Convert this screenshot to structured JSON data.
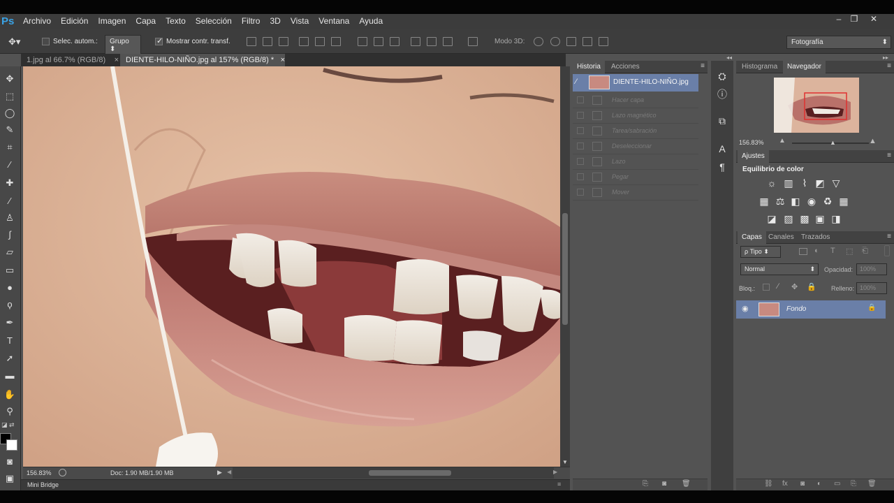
{
  "app": {
    "logo": "Ps"
  },
  "menu": [
    "Archivo",
    "Edición",
    "Imagen",
    "Capa",
    "Texto",
    "Selección",
    "Filtro",
    "3D",
    "Vista",
    "Ventana",
    "Ayuda"
  ],
  "window_controls": {
    "minimize": "–",
    "restore": "❐",
    "close": "✕"
  },
  "options": {
    "auto_select_label": "Selec. autom.:",
    "group_value": "Grupo",
    "show_transform_label": "Mostrar contr. transf.",
    "mode3d_label": "Modo 3D:",
    "workspace": "Fotografía"
  },
  "doc_tabs": [
    {
      "label": "1.jpg al 66.7% (RGB/8)",
      "close": "×"
    },
    {
      "label": "DIENTE-HILO-NIÑO.jpg al 157% (RGB/8) *",
      "close": "×"
    }
  ],
  "status": {
    "zoom": "156.83%",
    "doc": "Doc: 1.90 MB/1.90 MB"
  },
  "mini_bridge": "Mini Bridge",
  "history": {
    "tabs": [
      "Historia",
      "Acciones"
    ],
    "snapshot": "DIENTE-HILO-NIÑO.jpg",
    "items": [
      "Hacer capa",
      "Lazo magnético",
      "Tarea/sabración",
      "Deseleccionar",
      "Lazo",
      "Pegar",
      "Mover"
    ]
  },
  "navigator": {
    "tabs": [
      "Histograma",
      "Navegador"
    ],
    "zoom": "156.83%"
  },
  "adjustments": {
    "tab": "Ajustes",
    "title": "Equilibrio de color"
  },
  "layers": {
    "tabs": [
      "Capas",
      "Canales",
      "Trazados"
    ],
    "filter": "ρ Tipo",
    "blend_mode": "Normal",
    "opacity_label": "Opacidad:",
    "opacity_value": "100%",
    "lock_label": "Bloq.:",
    "fill_label": "Relleno:",
    "fill_value": "100%",
    "layer_name": "Fondo"
  }
}
